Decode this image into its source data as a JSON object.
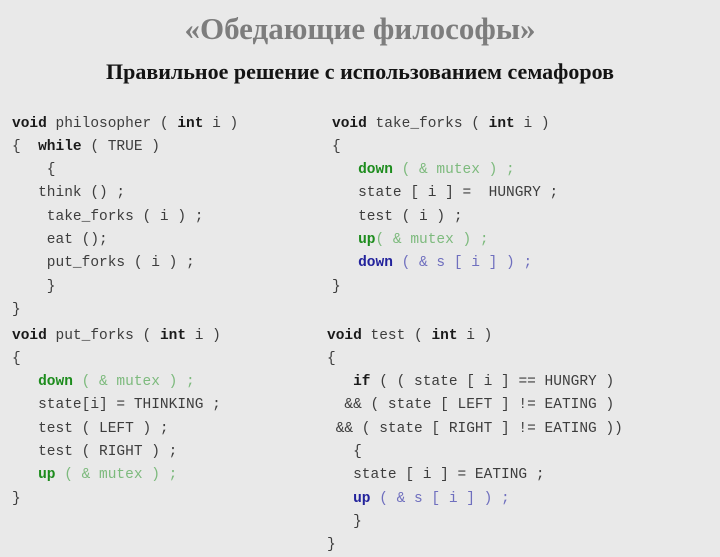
{
  "slide": {
    "title": "«Обедающие философы»",
    "subtitle": "Правильное решение с использованием семафоров",
    "background_color": "#e9e9e9",
    "title_color": "#7d7d7d",
    "subtitle_color": "#141414"
  },
  "colors": {
    "code_plain": "#3d3d3d",
    "code_keyword": "#1a1a1a",
    "semaphore_green_bold": "#1d8c1d",
    "semaphore_green_light": "#7dba7d",
    "semaphore_blue_bold": "#22229c",
    "semaphore_blue_light": "#6f6fbe"
  },
  "code_blocks": [
    {
      "id": "philosopher",
      "name": "philosopher",
      "lines": [
        [
          {
            "t": "void",
            "s": "kw"
          },
          {
            "t": " philosopher ( ",
            "s": "plain"
          },
          {
            "t": "int",
            "s": "kw"
          },
          {
            "t": " i )",
            "s": "plain"
          }
        ],
        [
          {
            "t": "{  ",
            "s": "plain"
          },
          {
            "t": "while",
            "s": "kw"
          },
          {
            "t": " ( TRUE )",
            "s": "plain"
          }
        ],
        [
          {
            "t": "    {",
            "s": "plain"
          }
        ],
        [
          {
            "t": "   think () ;",
            "s": "plain"
          }
        ],
        [
          {
            "t": "    take_forks ( i ) ;",
            "s": "plain"
          }
        ],
        [
          {
            "t": "    eat ();",
            "s": "plain"
          }
        ],
        [
          {
            "t": "    put_forks ( i ) ;",
            "s": "plain"
          }
        ],
        [
          {
            "t": "    }",
            "s": "plain"
          }
        ],
        [
          {
            "t": "}",
            "s": "plain"
          }
        ]
      ]
    },
    {
      "id": "take_forks",
      "name": "take_forks",
      "lines": [
        [
          {
            "t": "void",
            "s": "kw"
          },
          {
            "t": " take_forks ( ",
            "s": "plain"
          },
          {
            "t": "int",
            "s": "kw"
          },
          {
            "t": " i )",
            "s": "plain"
          }
        ],
        [
          {
            "t": "{",
            "s": "plain"
          }
        ],
        [
          {
            "t": "   ",
            "s": "plain"
          },
          {
            "t": "down",
            "s": "sem-b"
          },
          {
            "t": " ( & mutex ) ;",
            "s": "sem-l"
          }
        ],
        [
          {
            "t": "   state [ i ] =  HUNGRY ;",
            "s": "plain"
          }
        ],
        [
          {
            "t": "   test ( i ) ;",
            "s": "plain"
          }
        ],
        [
          {
            "t": "   ",
            "s": "plain"
          },
          {
            "t": "up",
            "s": "sem-b"
          },
          {
            "t": "( & mutex ) ;",
            "s": "sem-l"
          }
        ],
        [
          {
            "t": "   ",
            "s": "plain"
          },
          {
            "t": "down",
            "s": "semb-b"
          },
          {
            "t": " ( & s [ i ] ) ;",
            "s": "semb-l"
          }
        ],
        [
          {
            "t": "}",
            "s": "plain"
          }
        ]
      ]
    },
    {
      "id": "put_forks",
      "name": "put_forks",
      "lines": [
        [
          {
            "t": "void",
            "s": "kw"
          },
          {
            "t": " put_forks ( ",
            "s": "plain"
          },
          {
            "t": "int",
            "s": "kw"
          },
          {
            "t": " i )",
            "s": "plain"
          }
        ],
        [
          {
            "t": "{",
            "s": "plain"
          }
        ],
        [
          {
            "t": "   ",
            "s": "plain"
          },
          {
            "t": "down",
            "s": "sem-b"
          },
          {
            "t": " ( & mutex ) ;",
            "s": "sem-l"
          }
        ],
        [
          {
            "t": "   state[i] = THINKING ;",
            "s": "plain"
          }
        ],
        [
          {
            "t": "   test ( LEFT ) ;",
            "s": "plain"
          }
        ],
        [
          {
            "t": "   test ( RIGHT ) ;",
            "s": "plain"
          }
        ],
        [
          {
            "t": "   ",
            "s": "plain"
          },
          {
            "t": "up",
            "s": "sem-b"
          },
          {
            "t": " ( & mutex ) ;",
            "s": "sem-l"
          }
        ],
        [
          {
            "t": "}",
            "s": "plain"
          }
        ]
      ]
    },
    {
      "id": "test",
      "name": "test",
      "lines": [
        [
          {
            "t": "void",
            "s": "kw"
          },
          {
            "t": " test ( ",
            "s": "plain"
          },
          {
            "t": "int",
            "s": "kw"
          },
          {
            "t": " i )",
            "s": "plain"
          }
        ],
        [
          {
            "t": "{",
            "s": "plain"
          }
        ],
        [
          {
            "t": "   ",
            "s": "plain"
          },
          {
            "t": "if",
            "s": "kw"
          },
          {
            "t": " ( ( state [ i ] == HUNGRY )",
            "s": "plain"
          }
        ],
        [
          {
            "t": "  && ( state [ LEFT ] != EATING )",
            "s": "plain"
          }
        ],
        [
          {
            "t": " && ( state [ RIGHT ] != EATING ))",
            "s": "plain"
          }
        ],
        [
          {
            "t": "   {",
            "s": "plain"
          }
        ],
        [
          {
            "t": "   state [ i ] = EATING ;",
            "s": "plain"
          }
        ],
        [
          {
            "t": "   ",
            "s": "plain"
          },
          {
            "t": "up",
            "s": "semb-b"
          },
          {
            "t": " ( & s [ i ] ) ;",
            "s": "semb-l"
          }
        ],
        [
          {
            "t": "   }",
            "s": "plain"
          }
        ],
        [
          {
            "t": "}",
            "s": "plain"
          }
        ]
      ]
    }
  ]
}
